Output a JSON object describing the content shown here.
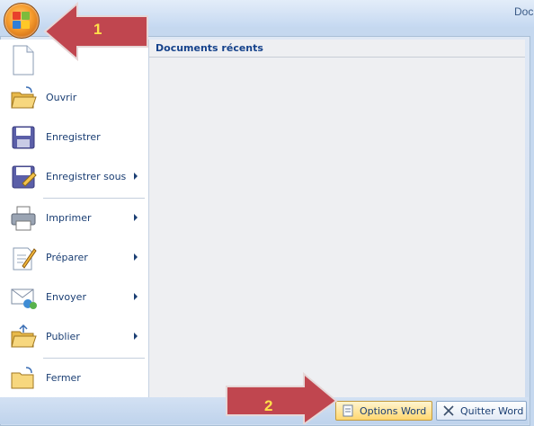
{
  "window": {
    "title": "Docu"
  },
  "office_button": {
    "icon": "office-button-icon"
  },
  "menu": {
    "items": [
      {
        "key": "nouveau",
        "label": "",
        "icon": "new-document-icon",
        "has_submenu": false
      },
      {
        "key": "ouvrir",
        "label": "Ouvrir",
        "icon": "open-folder-icon",
        "has_submenu": false
      },
      {
        "key": "enregistrer",
        "label": "Enregistrer",
        "icon": "save-disk-icon",
        "has_submenu": false
      },
      {
        "key": "enregistrer_sous",
        "label": "Enregistrer sous",
        "icon": "save-as-icon",
        "has_submenu": true
      },
      {
        "key": "imprimer",
        "label": "Imprimer",
        "icon": "printer-icon",
        "has_submenu": true
      },
      {
        "key": "preparer",
        "label": "Préparer",
        "icon": "prepare-pencil-icon",
        "has_submenu": true
      },
      {
        "key": "envoyer",
        "label": "Envoyer",
        "icon": "send-mail-icon",
        "has_submenu": true
      },
      {
        "key": "publier",
        "label": "Publier",
        "icon": "publish-folder-icon",
        "has_submenu": true
      },
      {
        "key": "fermer",
        "label": "Fermer",
        "icon": "close-folder-icon",
        "has_submenu": false
      }
    ]
  },
  "recent": {
    "title": "Documents récents"
  },
  "footer": {
    "options_label": "Options Word",
    "quit_label": "Quitter Word"
  },
  "callouts": [
    {
      "number": "1",
      "color": "#c0464f"
    },
    {
      "number": "2",
      "color": "#c0464f"
    }
  ]
}
